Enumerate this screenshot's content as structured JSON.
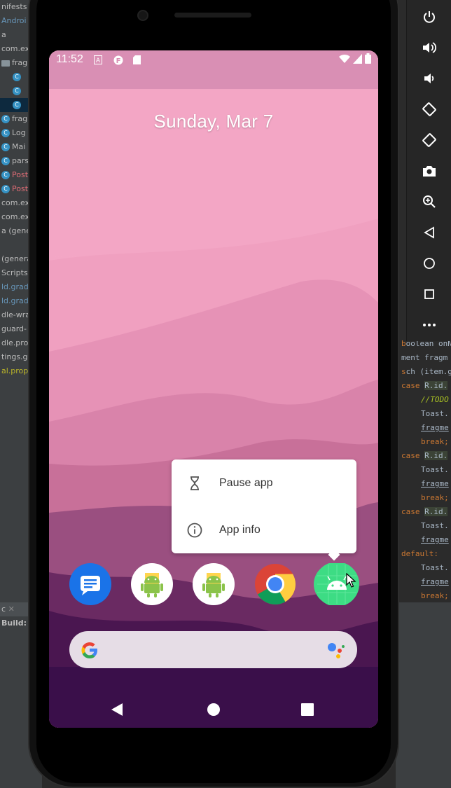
{
  "ide": {
    "tree_items": [
      {
        "label": "nifests",
        "badge": ""
      },
      {
        "label": "Androi",
        "badge": ""
      },
      {
        "label": "a",
        "badge": ""
      },
      {
        "label": "com.ex",
        "badge": ""
      },
      {
        "label": "frag",
        "badge": "folder"
      },
      {
        "label": "",
        "badge": "C"
      },
      {
        "label": "",
        "badge": "C"
      },
      {
        "label": "",
        "badge": "C"
      },
      {
        "label": "frag",
        "badge": "C"
      },
      {
        "label": "Log",
        "badge": "C"
      },
      {
        "label": "Mai",
        "badge": "C"
      },
      {
        "label": "pars",
        "badge": "C"
      },
      {
        "label": "Post",
        "badge": "C"
      },
      {
        "label": "Post",
        "badge": "C"
      },
      {
        "label": "com.ex",
        "badge": ""
      },
      {
        "label": "com.ex",
        "badge": ""
      },
      {
        "label": "a (gener",
        "badge": ""
      },
      {
        "label": "",
        "badge": ""
      },
      {
        "label": "(genera",
        "badge": ""
      },
      {
        "label": "Scripts",
        "badge": ""
      },
      {
        "label": "ld.gradl",
        "badge": ""
      },
      {
        "label": "ld.gradl",
        "badge": ""
      },
      {
        "label": "dle-wra",
        "badge": ""
      },
      {
        "label": "guard-",
        "badge": ""
      },
      {
        "label": "dle.prop",
        "badge": ""
      },
      {
        "label": "tings.gr",
        "badge": ""
      },
      {
        "label": "al.prope",
        "badge": ""
      }
    ],
    "bottom_tab": "c",
    "bottom_build": "Build: fir",
    "code": {
      "l1": "oolean onN",
      "l2": "ment fragm",
      "l3": "ch (item.g",
      "case": "case",
      "rid": "R.id.",
      "todo": "//TODO",
      "toast": "Toast.",
      "fragme": "fragme",
      "break": "break;",
      "default": "default:"
    }
  },
  "status_bar": {
    "time": "11:52"
  },
  "home": {
    "date": "Sunday, Mar 7"
  },
  "popup": {
    "items": [
      {
        "label": "Pause app",
        "icon": "hourglass-icon"
      },
      {
        "label": "App info",
        "icon": "info-icon"
      }
    ]
  },
  "dock": {
    "apps": [
      {
        "name": "messages-app-icon",
        "color": "#1a73e8"
      },
      {
        "name": "android-app-icon",
        "color": "#ffffff"
      },
      {
        "name": "android-app-icon",
        "color": "#ffffff"
      },
      {
        "name": "chrome-app-icon",
        "color": "#ffffff"
      },
      {
        "name": "android-green-app-icon",
        "color": "#3ddc84"
      }
    ]
  },
  "colors": {
    "wallpaper_top": "#f4a8c6",
    "wallpaper_bottom": "#3a0f4a",
    "popup_bg": "#ffffff",
    "ide_bg": "#3c3f41"
  }
}
